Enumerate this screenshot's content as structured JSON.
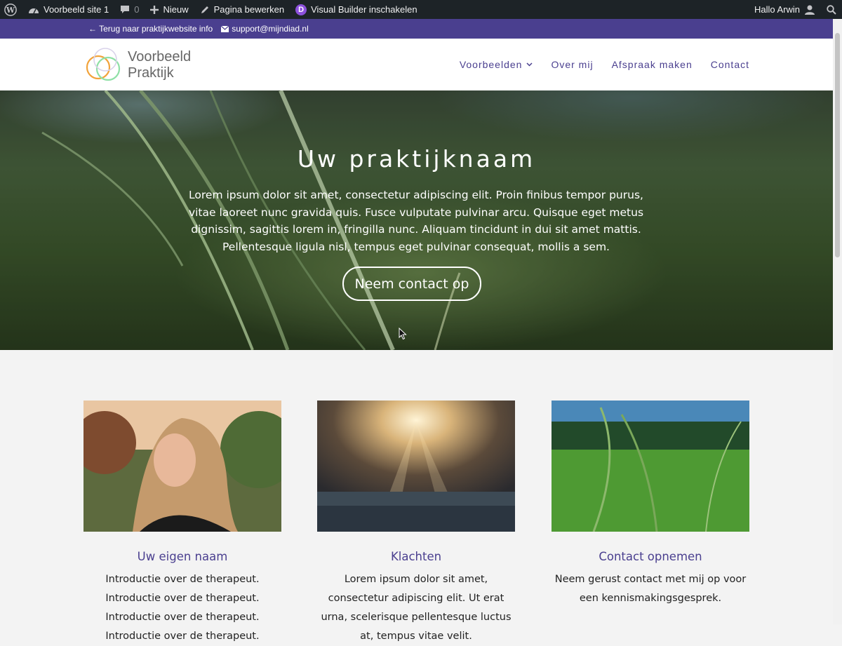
{
  "adminbar": {
    "site_name": "Voorbeeld site 1",
    "comments_count": "0",
    "new_label": "Nieuw",
    "edit_label": "Pagina bewerken",
    "visual_builder_label": "Visual Builder inschakelen",
    "greeting": "Hallo Arwin",
    "divi_letter": "D"
  },
  "topbar": {
    "back_link": "← Terug naar praktijkwebsite info",
    "email": "support@mijndiad.nl"
  },
  "header": {
    "logo_line1": "Voorbeeld",
    "logo_line2": "Praktijk",
    "nav": [
      {
        "label": "Voorbeelden"
      },
      {
        "label": "Over mij"
      },
      {
        "label": "Afspraak maken"
      },
      {
        "label": "Contact"
      }
    ]
  },
  "hero": {
    "title": "Uw praktijknaam",
    "text": "Lorem ipsum dolor sit amet, consectetur adipiscing elit. Proin finibus tempor purus, vitae laoreet nunc gravida quis. Fusce vulputate pulvinar arcu. Quisque eget metus dignissim, sagittis lorem in, fringilla nunc. Aliquam tincidunt in dui sit amet mattis. Pellentesque ligula nisl, tempus eget pulvinar consequat, mollis a sem.",
    "button": "Neem contact op"
  },
  "cards": [
    {
      "title": "Uw eigen naam",
      "text": "Introductie over de therapeut. Introductie over de therapeut. Introductie over de therapeut. Introductie over de therapeut."
    },
    {
      "title": "Klachten",
      "text": "Lorem ipsum dolor sit amet, consectetur adipiscing elit. Ut erat urna, scelerisque pellentesque  luctus at, tempus vitae velit."
    },
    {
      "title": "Contact opnemen",
      "text": "Neem gerust contact met mij op voor een kennismakingsgesprek."
    }
  ],
  "colors": {
    "brand_purple": "#4a3f8f",
    "adminbar_bg": "#1d2327"
  }
}
